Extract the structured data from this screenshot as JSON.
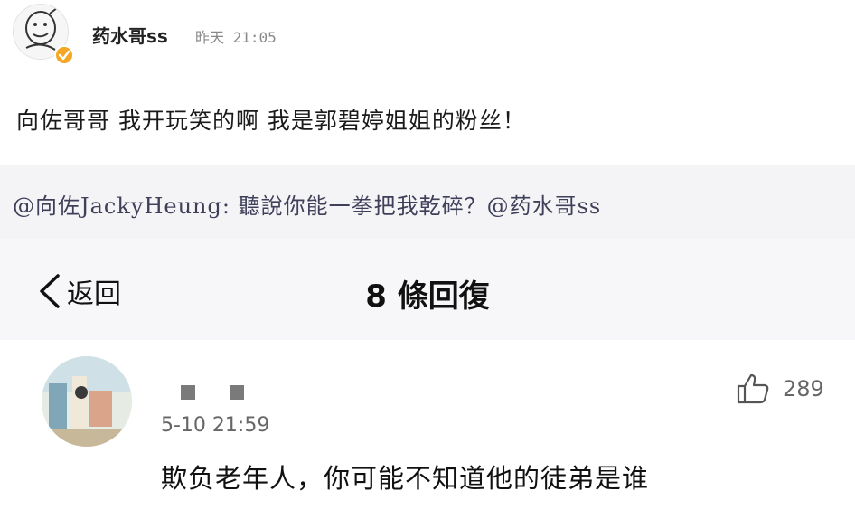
{
  "post": {
    "author": "药水哥ss",
    "time": "昨天 21:05",
    "text": "向佐哥哥  我开玩笑的啊  我是郭碧婷姐姐的粉丝！",
    "verified": true
  },
  "quote": {
    "text": "@向佐JackyHeung: 聽說你能一拳把我乾碎？@药水哥ss"
  },
  "navbar": {
    "back_label": "返回",
    "title": "8 條回復"
  },
  "reply": {
    "author_masked": "■ ■",
    "time": "5-10 21:59",
    "likes": "289",
    "text": "欺负老年人，你可能不知道他的徒弟是谁"
  },
  "colors": {
    "verify_badge": "#f5a623",
    "quote_background": "#f4f4f6",
    "navbar_background": "#f7f7f9"
  },
  "icons": {
    "back": "chevron-left-icon",
    "like": "thumbs-up-icon",
    "verify": "verified-badge-icon"
  }
}
